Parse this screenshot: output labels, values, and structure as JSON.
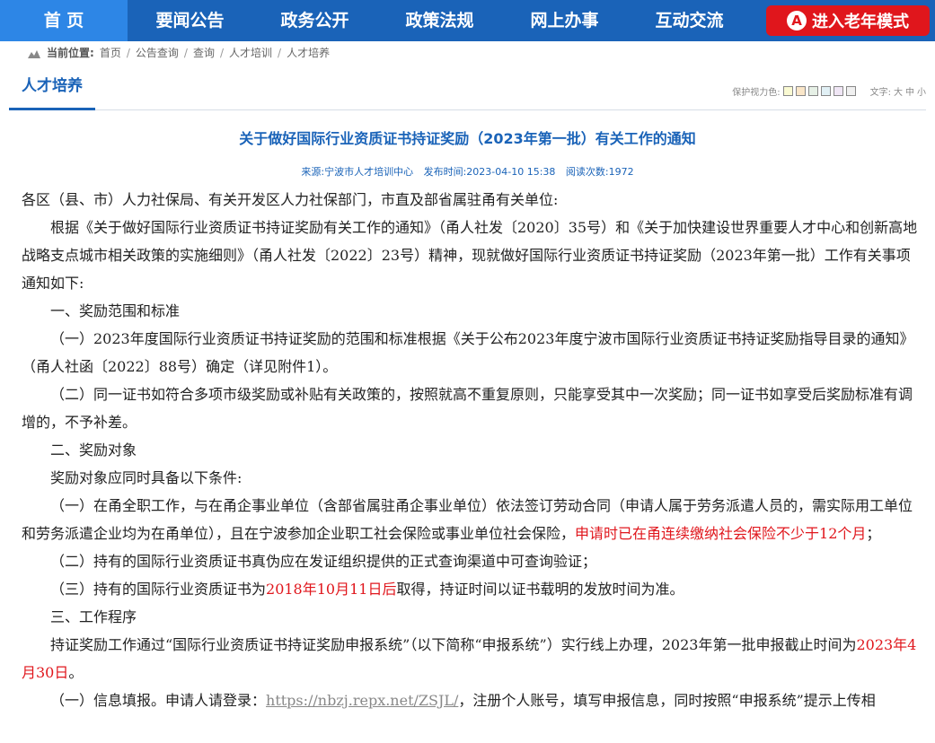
{
  "nav": {
    "items": [
      "首 页",
      "要闻公告",
      "政务公开",
      "政策法规",
      "网上办事",
      "互动交流"
    ],
    "elder_mode": "进入老年模式",
    "elder_icon": "A"
  },
  "breadcrumb": {
    "label": "当前位置:",
    "items": [
      "首页",
      "公告查询",
      "查询",
      "人才培训",
      "人才培养"
    ]
  },
  "tab": {
    "label": "人才培养"
  },
  "tools": {
    "color_label": "保护视力色:",
    "swatches": [
      "#fafad2",
      "#fae6c8",
      "#e6f0e6",
      "#e1f0f5",
      "#f0e6f5",
      "#f0f0f0"
    ],
    "font_label": "文字:",
    "sizes": [
      "大",
      "中",
      "小"
    ]
  },
  "article": {
    "title": "关于做好国际行业资质证书持证奖励（2023年第一批）有关工作的通知",
    "meta": {
      "source": "来源:宁波市人才培训中心",
      "published": "发布时间:2023-04-10 15:38",
      "reads": "阅读次数:1972"
    },
    "p1": "各区（县、市）人力社保局、有关开发区人力社保部门，市直及部省属驻甬有关单位:",
    "p2": "根据《关于做好国际行业资质证书持证奖励有关工作的通知》（甬人社发〔2020〕35号）和《关于加快建设世界重要人才中心和创新高地战略支点城市相关政策的实施细则》（甬人社发〔2022〕23号）精神，现就做好国际行业资质证书持证奖励（2023年第一批）工作有关事项通知如下:",
    "h1": "一、奖励范围和标准",
    "p3": "（一）2023年度国际行业资质证书持证奖励的范围和标准根据《关于公布2023年度宁波市国际行业资质证书持证奖励指导目录的通知》（甬人社函〔2022〕88号）确定（详见附件1）。",
    "p4": "（二）同一证书如符合多项市级奖励或补贴有关政策的，按照就高不重复原则，只能享受其中一次奖励；同一证书如享受后奖励标准有调增的，不予补差。",
    "h2": "二、奖励对象",
    "p5": "奖励对象应同时具备以下条件:",
    "p6a": "（一）在甬全职工作，与在甬企事业单位（含部省属驻甬企事业单位）依法签订劳动合同（申请人属于劳务派遣人员的，需实际用工单位和劳务派遣企业均为在甬单位），且在宁波参加企业职工社会保险或事业单位社会保险，",
    "p6red": "申请时已在甬连续缴纳社会保险不少于12个月",
    "p6b": "；",
    "p7": "（二）持有的国际行业资质证书真伪应在发证组织提供的正式查询渠道中可查询验证；",
    "p8a": "（三）持有的国际行业资质证书为",
    "p8red": "2018年10月11日后",
    "p8b": "取得，持证时间以证书载明的发放时间为准。",
    "h3": "三、工作程序",
    "p9a": "持证奖励工作通过“国际行业资质证书持证奖励申报系统”（以下简称“申报系统”）实行线上办理，2023年第一批申报截止时间为",
    "p9red": "2023年4月30日",
    "p9b": "。",
    "p10a": "（一）信息填报。申请人请登录：",
    "p10link": "https://nbzj.repx.net/ZSJL/",
    "p10b": "，注册个人账号，填写申报信息，同时按照“申报系统”提示上传相"
  }
}
